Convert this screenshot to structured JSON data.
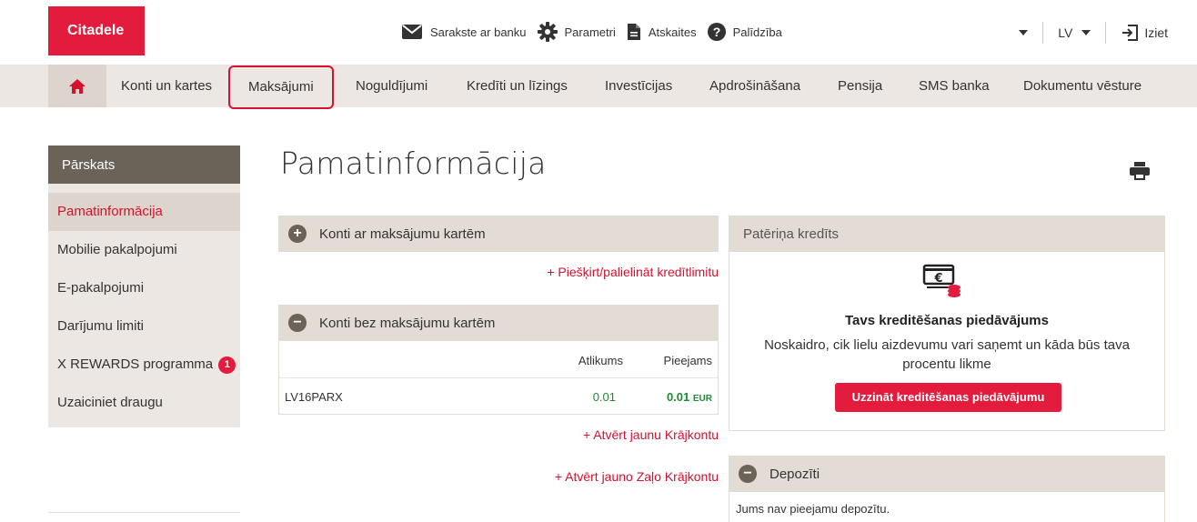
{
  "brand": {
    "logo": "Citadele",
    "accent": "#e31b3c"
  },
  "top_links": [
    {
      "icon": "envelope-icon",
      "label": "Sarakste ar banku"
    },
    {
      "icon": "gear-icon",
      "label": "Parametri"
    },
    {
      "icon": "document-icon",
      "label": "Atskaites"
    },
    {
      "icon": "help-icon",
      "label": "Palīdzība"
    }
  ],
  "header_right": {
    "language": "LV",
    "logout": "Iziet"
  },
  "nav": {
    "home_icon": "home-icon",
    "items": [
      {
        "label": "Konti un kartes"
      },
      {
        "label": "Maksājumi",
        "active": true
      },
      {
        "label": "Noguldījumi"
      },
      {
        "label": "Kredīti un līzings"
      },
      {
        "label": "Investīcijas"
      },
      {
        "label": "Apdrošināšana"
      },
      {
        "label": "Pensija"
      },
      {
        "label": "SMS banka"
      },
      {
        "label": "Dokumentu vēsture"
      }
    ]
  },
  "sidebar": {
    "title": "Pārskats",
    "items": [
      {
        "label": "Pamatinformācija",
        "active": true
      },
      {
        "label": "Mobilie pakalpojumi"
      },
      {
        "label": "E-pakalpojumi"
      },
      {
        "label": "Darījumu limiti"
      },
      {
        "label": "X REWARDS programma",
        "badge": "1"
      },
      {
        "label": "Uzaiciniet draugu"
      }
    ]
  },
  "main": {
    "title": "Pamatinformācija",
    "cards_panel": {
      "title": "Konti ar maksājumu kartēm",
      "link": "+ Piešķirt/palielināt kredītlimitu"
    },
    "accounts_panel": {
      "title": "Konti bez maksājumu kartēm",
      "columns": [
        "Atlikums",
        "Pieejams"
      ],
      "rows": [
        {
          "account": "LV16PARX",
          "balance": "0.01",
          "available": "0.01",
          "currency": "EUR"
        }
      ],
      "link_savings": "+ Atvērt jaunu Krājkontu",
      "link_green_savings": "+ Atvērt jauno Zaļo Krājkontu"
    }
  },
  "credit": {
    "title": "Patēriņa kredīts",
    "icon": "money-bill-icon",
    "offer_title": "Tavs kreditēšanas piedāvājums",
    "offer_text": "Noskaidro, cik lielu aizdevumu vari saņemt un kāda būs tava procentu likme",
    "button": "Uzzināt kreditēšanas piedāvājumu"
  },
  "deposits": {
    "title": "Depozīti",
    "empty_text": "Jums nav pieejamu depozītu."
  }
}
